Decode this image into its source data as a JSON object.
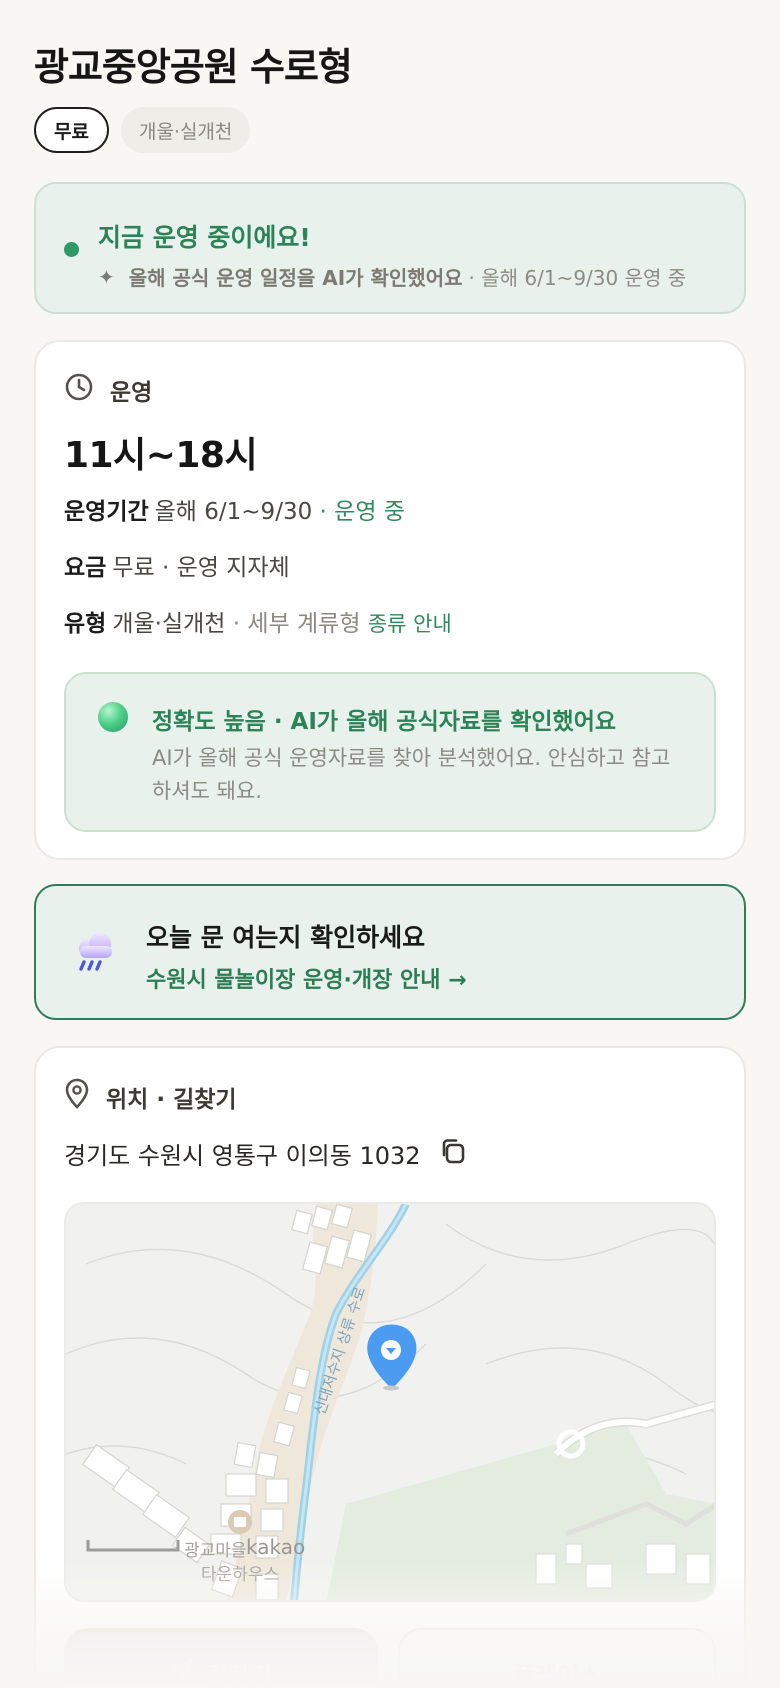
{
  "header": {
    "title": "광교중앙공원 수로형",
    "chips": [
      "무료",
      "개울·실개천"
    ]
  },
  "status": {
    "title": "지금 운영 중이에요!",
    "sub_strong": "올해 공식 운영 일정을 AI가 확인했어요",
    "sub_rest": "· 올해 6/1~9/30 운영 중"
  },
  "operation": {
    "section_title": "운영",
    "hours": "11시~18시",
    "period_label": "운영기간",
    "period_value": "올해 6/1~9/30",
    "period_status": "· 운영 중",
    "fee_label": "요금",
    "fee_value": "무료 · 운영 지자체",
    "type_label": "유형",
    "type_value": "개울·실개천",
    "type_detail": "· 세부 계류형",
    "type_guide": "종류 안내",
    "accuracy": {
      "title": "정확도 높음 · AI가 올해 공식자료를 확인했어요",
      "desc": "AI가 올해 공식 운영자료를 찾아 분석했어요. 안심하고 참고하셔도 돼요."
    }
  },
  "cta": {
    "title": "오늘 문 여는지 확인하세요",
    "link": "수원시 물놀이장 운영·개장 안내 →"
  },
  "location": {
    "section_title": "위치 · 길찾기",
    "address": "경기도 수원시 영통구 이의동 1032",
    "map": {
      "stream_label": "신대저수지 상류 수로",
      "logo": "kakao",
      "poi_label_1": "광교마을",
      "poi_label_2": "타운하우스"
    },
    "buttons": {
      "directions": "길찾기",
      "place": "플레이스"
    }
  },
  "colors": {
    "accent_green": "#2c8357",
    "background": "#f8f7f4",
    "card_tint": "#e8f1ec"
  }
}
